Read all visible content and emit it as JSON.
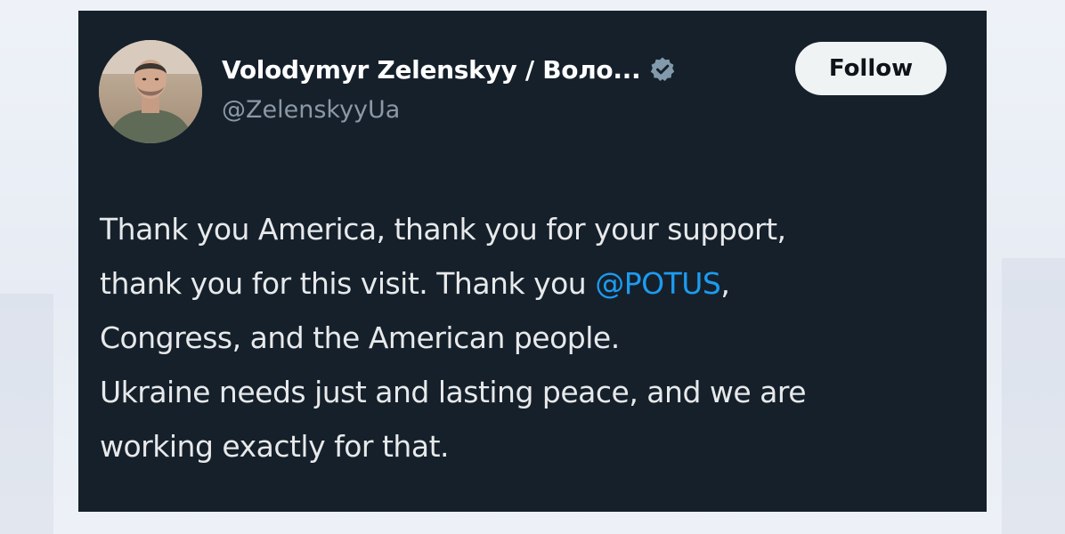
{
  "tweet": {
    "author": {
      "display_name": "Volodymyr Zelenskyy / Воло...",
      "handle": "@ZelenskyyUa",
      "verified": true,
      "avatar": "profile-photo"
    },
    "follow_label": "Follow",
    "text": {
      "line1": "Thank you America, thank you for your support,",
      "line2_before": "thank you for this visit. Thank you ",
      "mention": "@POTUS",
      "line2_after": ",",
      "line3": "Congress, and the American people.",
      "line4": "Ukraine needs just and lasting peace, and we are",
      "line5": "working exactly for that."
    }
  },
  "colors": {
    "card_background": "#15202b",
    "text_primary": "#e7e9ea",
    "text_secondary": "#8b98a5",
    "mention": "#1d9bf0",
    "follow_button_bg": "#eff3f4",
    "verified_badge": "#829aab"
  }
}
